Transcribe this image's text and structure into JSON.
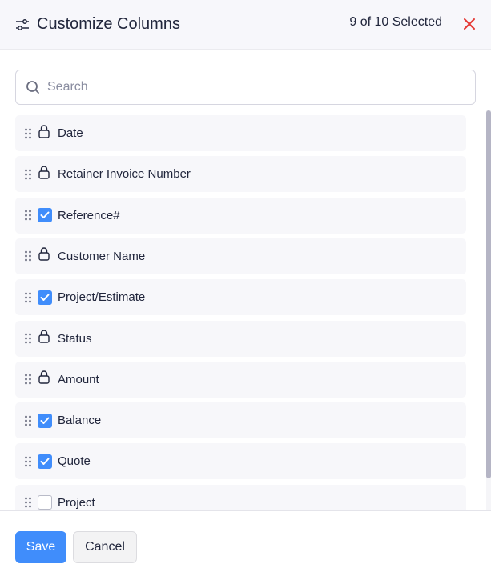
{
  "header": {
    "title": "Customize Columns",
    "icon": "sliders-icon",
    "selection_count": "9 of 10 Selected",
    "close_icon": "close-icon",
    "close_color": "#e53935"
  },
  "search": {
    "placeholder": "Search",
    "value": ""
  },
  "columns": [
    {
      "label": "Date",
      "state": "locked"
    },
    {
      "label": "Retainer Invoice Number",
      "state": "locked"
    },
    {
      "label": "Reference#",
      "state": "checked"
    },
    {
      "label": "Customer Name",
      "state": "locked"
    },
    {
      "label": "Project/Estimate",
      "state": "checked"
    },
    {
      "label": "Status",
      "state": "locked"
    },
    {
      "label": "Amount",
      "state": "locked"
    },
    {
      "label": "Balance",
      "state": "checked"
    },
    {
      "label": "Quote",
      "state": "checked"
    },
    {
      "label": "Project",
      "state": "unchecked"
    }
  ],
  "footer": {
    "save_label": "Save",
    "cancel_label": "Cancel"
  },
  "colors": {
    "accent": "#408dfb",
    "close": "#e53935"
  }
}
